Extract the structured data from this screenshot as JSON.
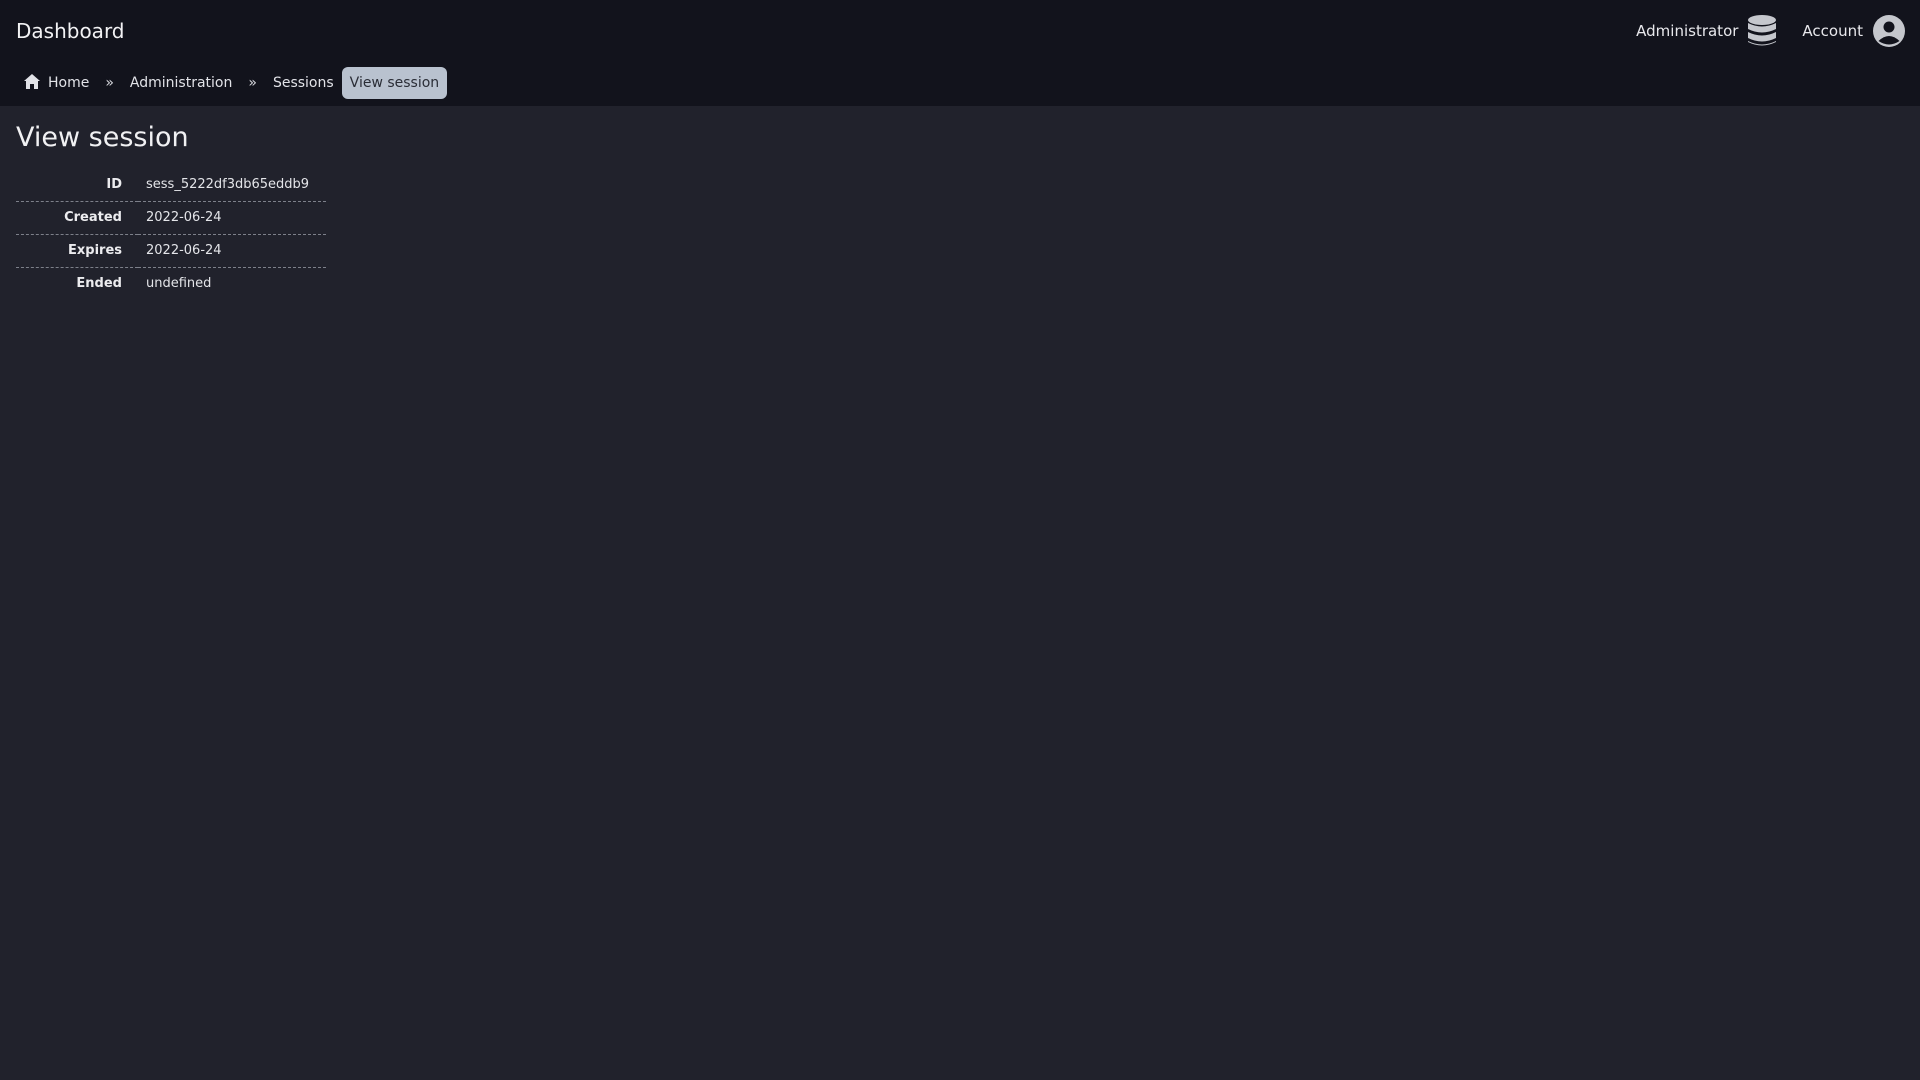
{
  "header": {
    "title": "Dashboard",
    "admin_label": "Administrator",
    "admin_icon": "database-icon",
    "account_label": "Account",
    "account_icon": "user-circle-icon"
  },
  "breadcrumb": {
    "home_label": "Home",
    "home_icon": "home-icon",
    "separator": "»",
    "items": [
      "Administration",
      "Sessions"
    ],
    "active": "View session"
  },
  "page": {
    "title": "View session"
  },
  "session": {
    "fields": [
      {
        "label": "ID",
        "value": "sess_5222df3db65eddb9"
      },
      {
        "label": "Created",
        "value": "2022-06-24"
      },
      {
        "label": "Expires",
        "value": "2022-06-24"
      },
      {
        "label": "Ended",
        "value": "undefined"
      }
    ]
  },
  "colors": {
    "background": "#21222c",
    "topbar": "#12131c",
    "active_crumb": "#b9c2cf"
  }
}
